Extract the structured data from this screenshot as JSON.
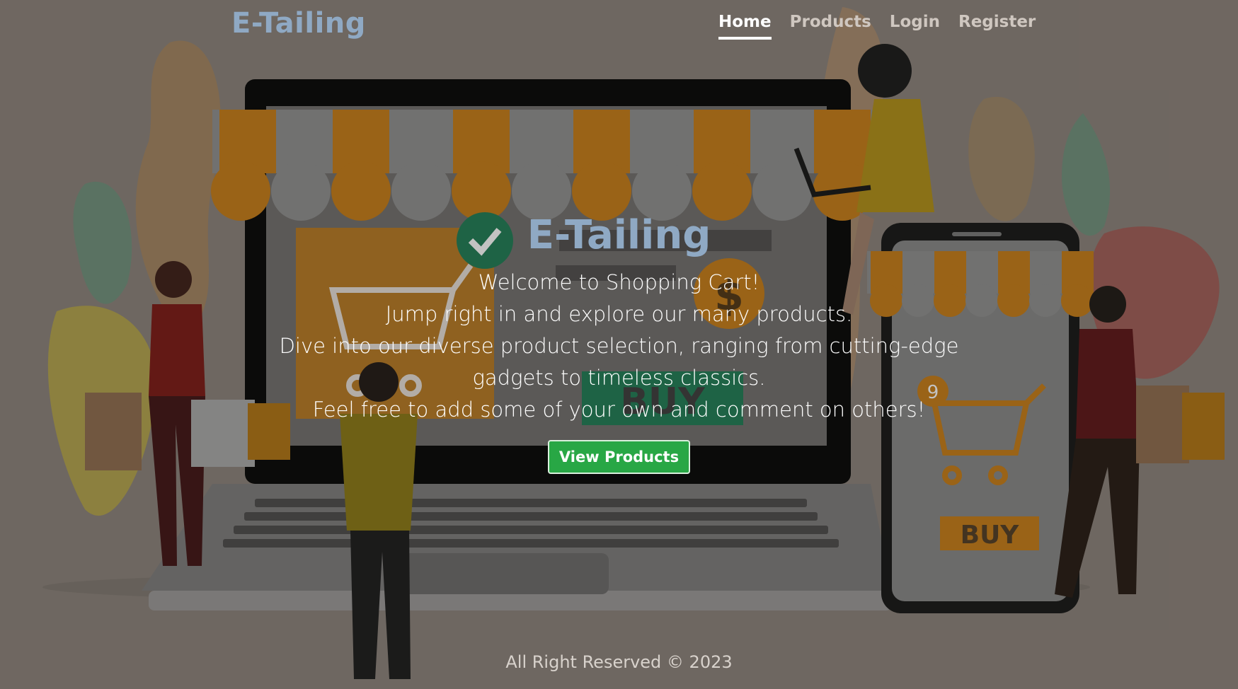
{
  "brand": "E-Tailing",
  "nav": {
    "home": "Home",
    "products": "Products",
    "login": "Login",
    "register": "Register"
  },
  "illustration": {
    "screen_buy": "BUY",
    "phone_buy": "BUY",
    "cart_badge": "9",
    "coin": "$"
  },
  "hero": {
    "title": "E-Tailing",
    "line1": "Welcome to Shopping Cart!",
    "line2": "Jump right in and explore our many products.",
    "line3": "Dive into our diverse product selection, ranging from cutting-edge gadgets to timeless classics.",
    "line4": "Feel free to add some of your own and comment on others!",
    "cta": "View Products"
  },
  "footer": "All Right Reserved © 2023",
  "colors": {
    "brand": "#8fa9c4",
    "cta": "#28a745",
    "awning": "#c67a12"
  }
}
